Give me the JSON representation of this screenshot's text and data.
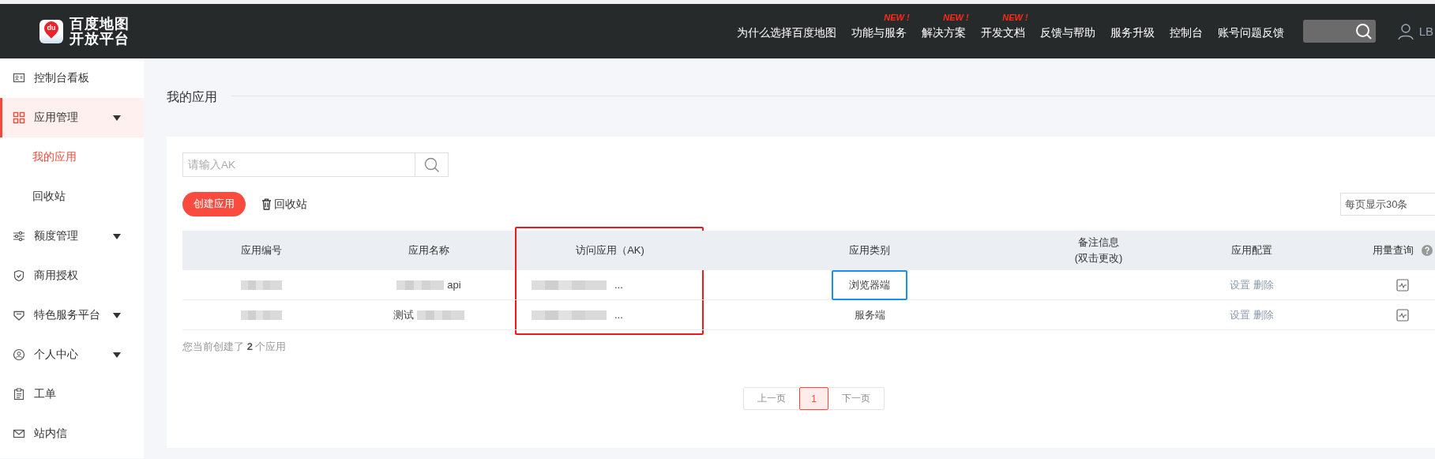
{
  "header": {
    "logo": {
      "badge": "du",
      "lines": [
        "百度地图",
        "开放平台"
      ]
    },
    "nav": [
      {
        "label": "为什么选择百度地图"
      },
      {
        "label": "功能与服务",
        "badge": "NEW !"
      },
      {
        "label": "解决方案",
        "badge": "NEW !"
      },
      {
        "label": "开发文档",
        "badge": "NEW !"
      },
      {
        "label": "反馈与帮助"
      },
      {
        "label": "服务升级"
      },
      {
        "label": "控制台"
      },
      {
        "label": "账号问题反馈"
      }
    ],
    "user": "LB"
  },
  "sidebar": {
    "items": [
      {
        "label": "控制台看板",
        "kind": "link",
        "selected": false
      },
      {
        "label": "应用管理",
        "kind": "menu",
        "selected": true,
        "children": [
          {
            "label": "我的应用",
            "selected": true
          },
          {
            "label": "回收站",
            "selected": false
          }
        ]
      },
      {
        "label": "额度管理",
        "kind": "menu",
        "selected": false
      },
      {
        "label": "商用授权",
        "kind": "link",
        "selected": false
      },
      {
        "label": "特色服务平台",
        "kind": "menu",
        "selected": false
      },
      {
        "label": "个人中心",
        "kind": "menu",
        "selected": false
      },
      {
        "label": "工单",
        "kind": "link",
        "selected": false
      },
      {
        "label": "站内信",
        "kind": "link",
        "selected": false
      }
    ]
  },
  "page_title": "我的应用",
  "search": {
    "placeholder": "请输入AK"
  },
  "create_button": "创建应用",
  "recycle_link": "回收站",
  "page_size": "每页显示30条",
  "table": {
    "columns": [
      {
        "label": "应用编号",
        "highlighted": false
      },
      {
        "label": "应用名称",
        "highlighted": false
      },
      {
        "label": "访问应用（AK)",
        "highlighted": true
      },
      {
        "label": "应用类别",
        "highlighted": false
      },
      {
        "label": "备注信息",
        "sublabel": "(双击更改)",
        "highlighted": false
      },
      {
        "label": "应用配置",
        "highlighted": false
      },
      {
        "label": "用量查询",
        "help": true,
        "highlighted": false
      }
    ],
    "rows": [
      [
        {
          "parts": [
            {
              "kind": "blur"
            }
          ]
        },
        {
          "parts": [
            {
              "kind": "blur"
            },
            {
              "kind": "text",
              "text": "api",
              "highlighted": false
            }
          ]
        },
        {
          "parts": [
            {
              "kind": "blur"
            },
            {
              "kind": "text",
              "text": "...",
              "highlighted": false
            }
          ]
        },
        {
          "parts": [
            {
              "kind": "text",
              "text": "浏览器端",
              "highlighted": true
            }
          ]
        },
        {},
        {
          "parts": [
            {
              "kind": "link",
              "text": "设置"
            },
            {
              "kind": "link",
              "text": "删除"
            }
          ]
        },
        {
          "parts": [
            {
              "kind": "chart-icon"
            }
          ]
        }
      ],
      [
        {
          "parts": [
            {
              "kind": "blur"
            }
          ]
        },
        {
          "parts": [
            {
              "kind": "text",
              "text": "测试",
              "highlighted": false
            },
            {
              "kind": "blur"
            }
          ]
        },
        {
          "parts": [
            {
              "kind": "blur"
            },
            {
              "kind": "text",
              "text": "...",
              "highlighted": false
            }
          ]
        },
        {
          "parts": [
            {
              "kind": "text",
              "text": "服务端",
              "highlighted": false
            }
          ]
        },
        {},
        {
          "parts": [
            {
              "kind": "link",
              "text": "设置"
            },
            {
              "kind": "link",
              "text": "删除"
            }
          ]
        },
        {
          "parts": [
            {
              "kind": "chart-icon"
            }
          ]
        }
      ]
    ]
  },
  "summary": "您当前创建了 **2** 个应用",
  "pagination": {
    "prev": "上一页",
    "pages": [
      {
        "label": "1",
        "selected": true
      }
    ],
    "next": "下一页"
  }
}
